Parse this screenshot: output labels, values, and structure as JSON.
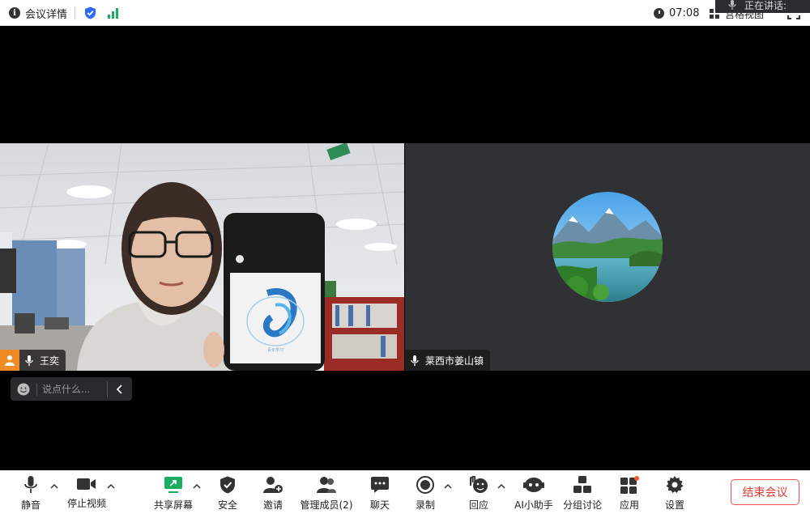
{
  "topbar": {
    "meeting_details": "会议详情",
    "time": "07:08",
    "view_label": "宫格视图",
    "speaking_label": "正在讲话:"
  },
  "participants": [
    {
      "name": "王奕",
      "mic": "mic-icon"
    },
    {
      "name": "莱西市姜山镇",
      "mic": "mic-icon"
    }
  ],
  "phone_logo_caption": "青年学习",
  "chat": {
    "placeholder": "说点什么..."
  },
  "toolbar": {
    "mute": "静音",
    "stop_video": "停止视频",
    "share_screen": "共享屏幕",
    "security": "安全",
    "invite": "邀请",
    "manage_members": "管理成员(2)",
    "chat": "聊天",
    "record": "录制",
    "reactions": "回应",
    "ai_assistant": "AI小助手",
    "breakout": "分组讨论",
    "apps": "应用",
    "settings": "设置",
    "end_meeting": "结束会议"
  },
  "colors": {
    "accent_green": "#1aad5f",
    "end_red": "#e53935",
    "shield_blue": "#2f6bff",
    "notify_dot": "#f05a28"
  }
}
